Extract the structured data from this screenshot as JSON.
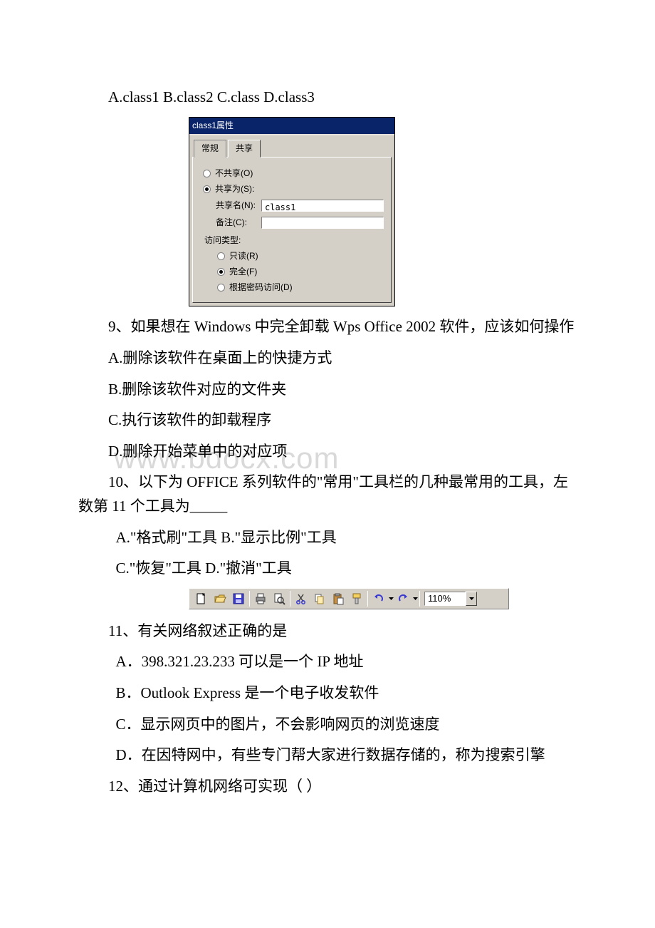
{
  "q8": {
    "options_line": "A.class1  B.class2  C.class D.class3"
  },
  "dialog": {
    "title": "class1属性",
    "tabs": {
      "general": "常规",
      "sharing": "共享"
    },
    "share": {
      "not_shared": "不共享(O)",
      "share_as": "共享为(S):",
      "share_name_label": "共享名(N):",
      "share_name_value": "class1",
      "comment_label": "备注(C):",
      "access_label": "访问类型:",
      "readonly": "只读(R)",
      "full": "完全(F)",
      "password": "根据密码访问(D)"
    }
  },
  "q9": {
    "stem": "9、如果想在 Windows 中完全卸载 Wps Office 2002 软件，应该如何操作",
    "a": "A.删除该软件在桌面上的快捷方式",
    "b": "B.删除该软件对应的文件夹",
    "c": "C.执行该软件的卸载程序",
    "d": "D.删除开始菜单中的对应项"
  },
  "q10": {
    "stem1": "10、以下为 OFFICE 系列软件的\"常用\"工具栏的几种最常用的工具，左数第 11 个工具为_____",
    "ab": "A.\"格式刷\"工具    B.\"显示比例\"工具",
    "cd": "C.\"恢复\"工具      D.\"撤消\"工具"
  },
  "toolbar": {
    "zoom": "110%"
  },
  "watermark": "www.bdocx.com",
  "q11": {
    "stem": "11、有关网络叙述正确的是",
    "a": "A．398.321.23.233 可以是一个 IP 地址",
    "b": "B．Outlook Express 是一个电子收发软件",
    "c": "C．显示网页中的图片，不会影响网页的浏览速度",
    "d": "D．在因特网中，有些专门帮大家进行数据存储的，称为搜索引擎"
  },
  "q12": {
    "stem": "12、通过计算机网络可实现（   ）"
  }
}
